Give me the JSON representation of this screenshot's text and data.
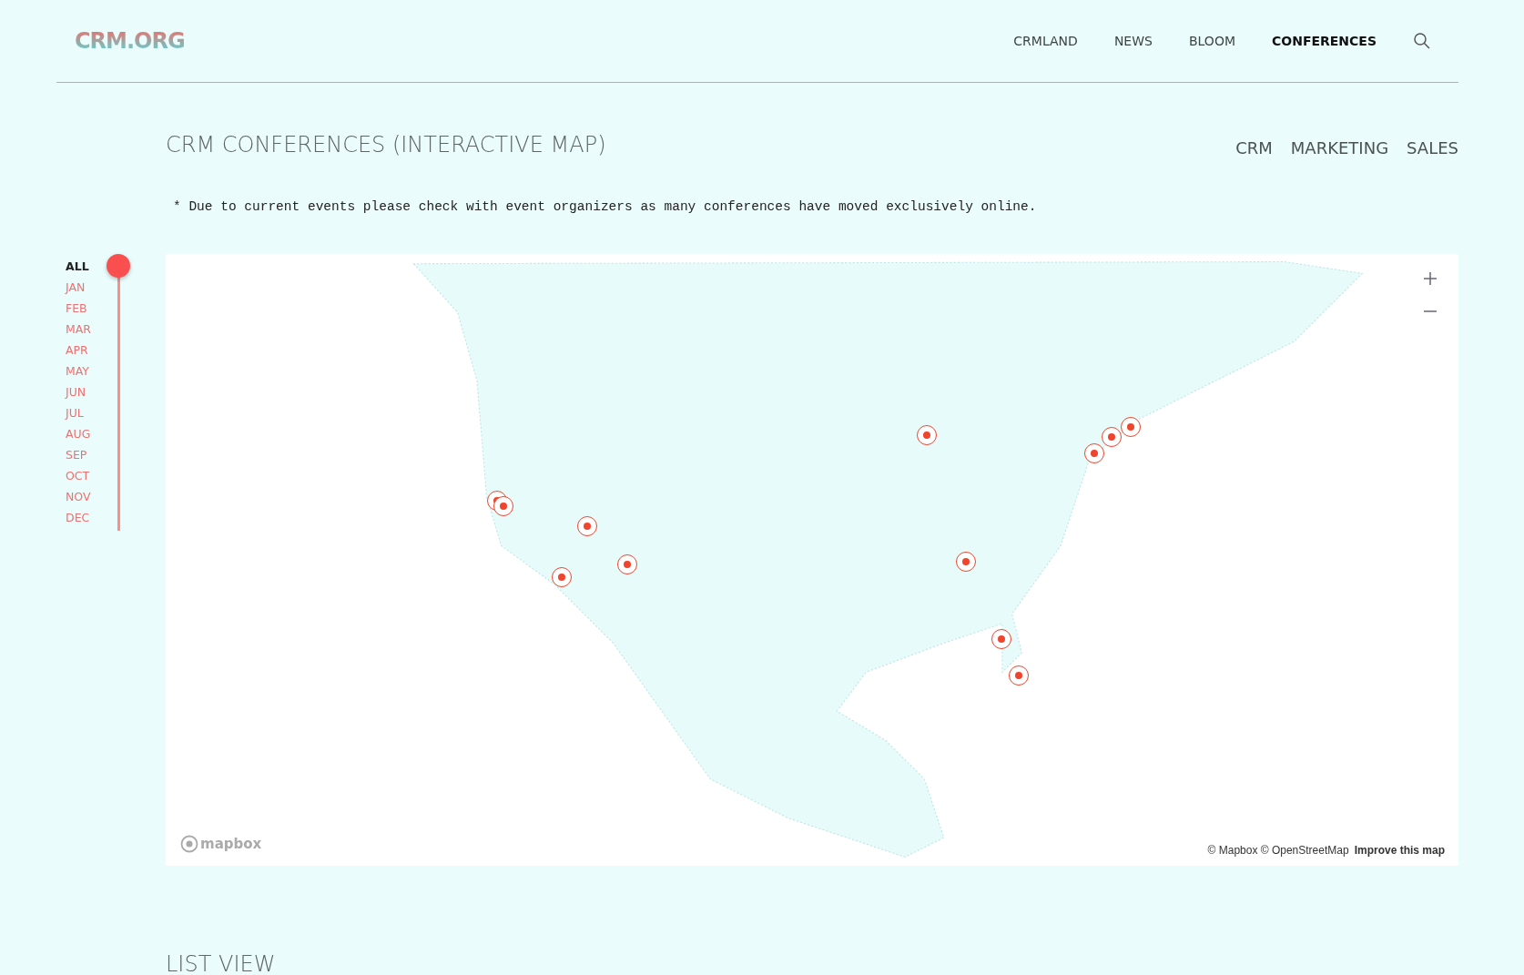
{
  "header": {
    "logo": "CRM.ORG",
    "nav": [
      {
        "label": "CRMLAND",
        "selected": false
      },
      {
        "label": "NEWS",
        "selected": false
      },
      {
        "label": "BLOOM",
        "selected": false
      },
      {
        "label": "CONFERENCES",
        "selected": true
      }
    ]
  },
  "page_title": "CRM CONFERENCES (INTERACTIVE MAP)",
  "filters": [
    {
      "label": "CRM"
    },
    {
      "label": "MARKETING"
    },
    {
      "label": "SALES"
    }
  ],
  "notice": "* Due to current events please check with event organizers as many conferences have moved exclusively online.",
  "months": [
    {
      "label": "ALL",
      "selected": true
    },
    {
      "label": "JAN",
      "selected": false
    },
    {
      "label": "FEB",
      "selected": false
    },
    {
      "label": "MAR",
      "selected": false
    },
    {
      "label": "APR",
      "selected": false
    },
    {
      "label": "MAY",
      "selected": false
    },
    {
      "label": "JUN",
      "selected": false
    },
    {
      "label": "JUL",
      "selected": false
    },
    {
      "label": "AUG",
      "selected": false
    },
    {
      "label": "SEP",
      "selected": false
    },
    {
      "label": "OCT",
      "selected": false
    },
    {
      "label": "NOV",
      "selected": false
    },
    {
      "label": "DEC",
      "selected": false
    }
  ],
  "map": {
    "logo": "mapbox",
    "attribution": "© Mapbox © OpenStreetMap",
    "improve_link": "Improve this map"
  },
  "list_view_title": "LIST VIEW"
}
